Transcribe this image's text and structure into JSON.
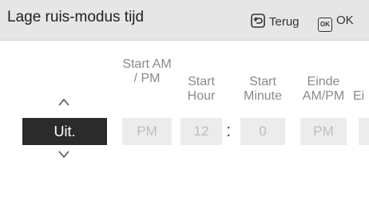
{
  "header": {
    "title": "Lage ruis-modus tijd",
    "back_label": "Terug",
    "ok_icon_text": "OK",
    "ok_label": "OK"
  },
  "mode": {
    "value": "Uit."
  },
  "columns": [
    {
      "label": "Start AM / PM",
      "value": "PM"
    },
    {
      "label": "Start Hour",
      "value": "12"
    },
    {
      "label": "Start Minute",
      "value": "0"
    },
    {
      "label": "Einde AM/PM",
      "value": "PM"
    },
    {
      "label": "Ei",
      "value": ""
    }
  ],
  "time_separator": ":"
}
